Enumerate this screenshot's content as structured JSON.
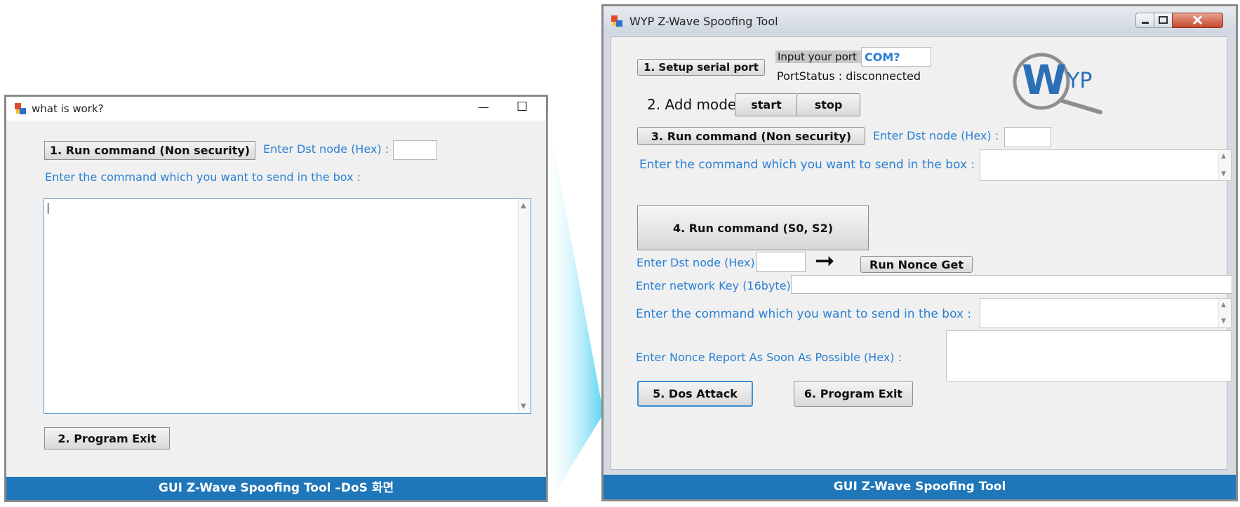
{
  "left_window": {
    "title": "what is work?",
    "minimize_glyph": "—",
    "maximize_glyph": "☐",
    "run_button": "1. Run command (Non security)",
    "dst_label": "Enter Dst node (Hex) :",
    "dst_value": "",
    "command_label": "Enter the command which you want to send in the box :",
    "command_value": "|",
    "exit_button": "2. Program Exit",
    "caption": "GUI Z-Wave Spoofing Tool –DoS 화면"
  },
  "right_window": {
    "title": "WYP Z-Wave Spoofing Tool",
    "setup_button": "1. Setup serial port",
    "port_label": "Input your port :",
    "port_value": "COM?",
    "port_status": "PortStatus : disconnected",
    "add_mode_label": "2. Add mode",
    "start_button": "start",
    "stop_button": "stop",
    "run_non_security_button": "3. Run command (Non security)",
    "dst_label_1": "Enter Dst node (Hex) :",
    "command_label_1": "Enter the command which you want to send in the box :",
    "run_s0s2_button": "4. Run command (S0, S2)",
    "dst_label_2": "Enter Dst node (Hex) :",
    "arrow_glyph": "➞",
    "nonce_get_button": "Run Nonce Get",
    "network_key_label": "Enter network Key (16byte) :",
    "command_label_2": "Enter the command which you want to send in the box :",
    "nonce_report_label": "Enter Nonce Report As Soon As Possible (Hex) :",
    "dos_button": "5. Dos Attack",
    "exit_button": "6. Program Exit",
    "logo_text_w": "W",
    "logo_text_yp": "YP",
    "caption": "GUI Z-Wave Spoofing Tool"
  },
  "colors": {
    "label_blue": "#2a7fd4",
    "caption_blue": "#1f76b9",
    "logo_blue": "#2b6fb7",
    "logo_gray": "#8e8e8e"
  }
}
